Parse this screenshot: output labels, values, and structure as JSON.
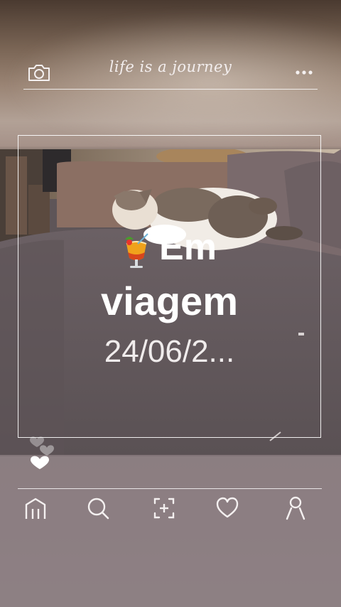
{
  "header": {
    "title": "life is a journey",
    "camera_icon": "camera-icon",
    "more_icon": "more-dots-icon"
  },
  "story": {
    "emoji": "tropical-drink-emoji",
    "line1": "Em",
    "line2": "viagem",
    "line3": "24/06/2..."
  },
  "reactions": {
    "icon": "floating-hearts-icon"
  },
  "bottom_nav": [
    {
      "name": "home",
      "icon": "home-icon"
    },
    {
      "name": "search",
      "icon": "search-icon"
    },
    {
      "name": "scan",
      "icon": "scan-add-icon"
    },
    {
      "name": "likes",
      "icon": "heart-icon"
    },
    {
      "name": "profile",
      "icon": "profile-icon"
    }
  ],
  "colors": {
    "text": "#ffffff",
    "line": "#ffffff",
    "sofa": "#5e5558"
  }
}
